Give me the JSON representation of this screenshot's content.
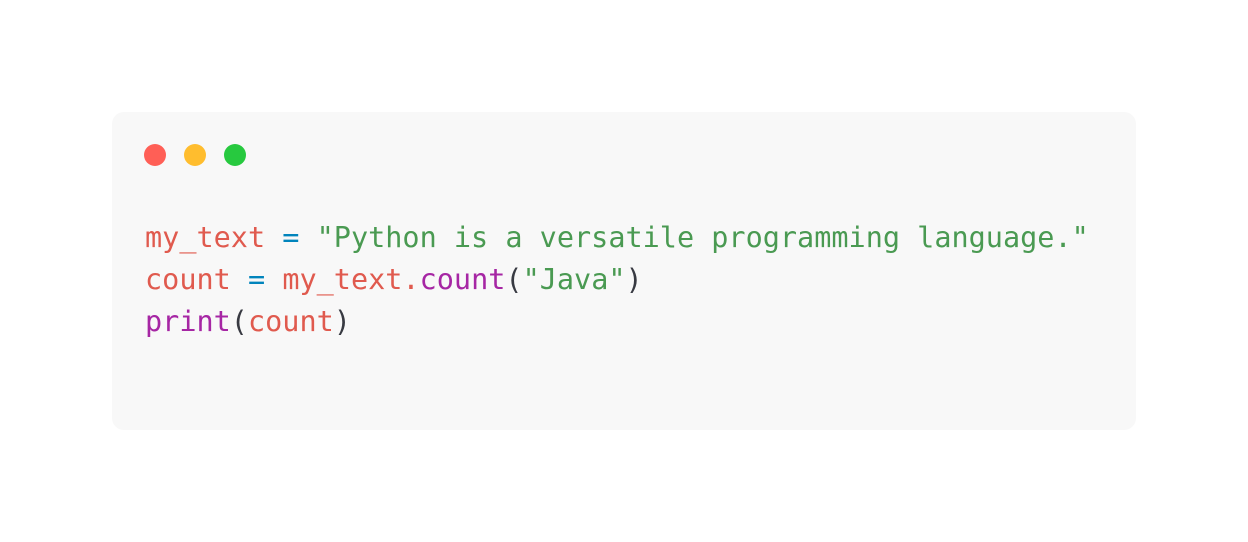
{
  "card": {
    "background_color": "#f8f8f8",
    "page_background_color": "#ffffff",
    "corner_radius": "12px"
  },
  "window_controls": {
    "close_label": "",
    "minimize_label": "",
    "maximize_label": "",
    "colors": {
      "close": "#ff5f56",
      "minimize": "#ffbd2e",
      "maximize": "#27c93f"
    }
  },
  "syntax_colors": {
    "variable": "#e05a4e",
    "operator": "#0184bc",
    "string": "#4a9a52",
    "function": "#a626a4",
    "punctuation": "#383a42"
  },
  "code": {
    "language": "python",
    "full_text": "my_text = \"Python is a versatile programming language.\"\ncount = my_text.count(\"Java\")\nprint(count)",
    "lines": [
      {
        "number": 1,
        "text": "my_text = \"Python is a versatile programming language.\"",
        "tokens": [
          {
            "t": "my_text",
            "k": "variable"
          },
          {
            "t": " ",
            "k": "plain"
          },
          {
            "t": "=",
            "k": "operator"
          },
          {
            "t": " ",
            "k": "plain"
          },
          {
            "t": "\"Python is a versatile programming language.\"",
            "k": "string"
          }
        ]
      },
      {
        "number": 2,
        "text": "count = my_text.count(\"Java\")",
        "tokens": [
          {
            "t": "count",
            "k": "variable"
          },
          {
            "t": " ",
            "k": "plain"
          },
          {
            "t": "=",
            "k": "operator"
          },
          {
            "t": " ",
            "k": "plain"
          },
          {
            "t": "my_text.",
            "k": "variable"
          },
          {
            "t": "count",
            "k": "function"
          },
          {
            "t": "(",
            "k": "punctuation"
          },
          {
            "t": "\"Java\"",
            "k": "string"
          },
          {
            "t": ")",
            "k": "punctuation"
          }
        ]
      },
      {
        "number": 3,
        "text": "print(count)",
        "tokens": [
          {
            "t": "print",
            "k": "function"
          },
          {
            "t": "(",
            "k": "punctuation"
          },
          {
            "t": "count",
            "k": "variable"
          },
          {
            "t": ")",
            "k": "punctuation"
          }
        ]
      }
    ]
  }
}
